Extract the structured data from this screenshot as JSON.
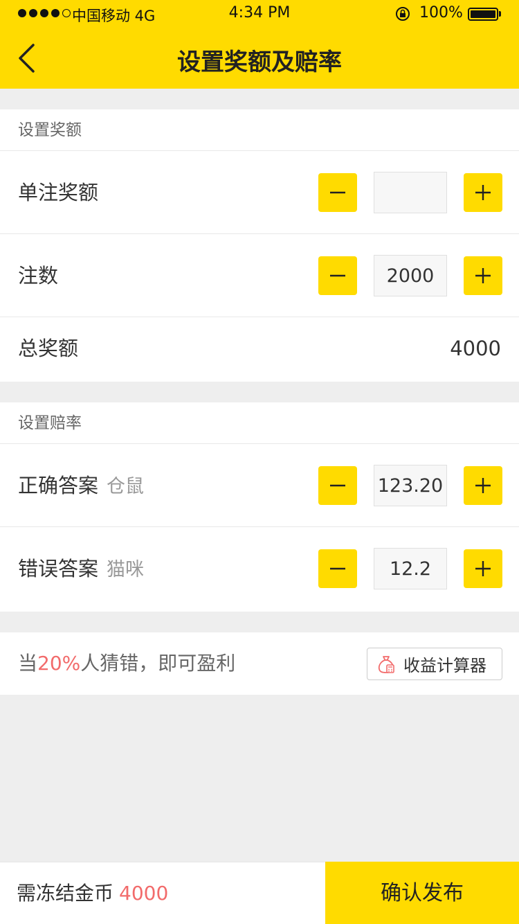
{
  "status_bar": {
    "carrier": "中国移动  4G",
    "time": "4:34 PM",
    "battery": "100%"
  },
  "nav": {
    "title": "设置奖额及赔率",
    "back_icon": "chevron-left-icon"
  },
  "prize_section": {
    "title": "设置奖额",
    "single_bet": {
      "label": "单注奖额",
      "value": ""
    },
    "bet_count": {
      "label": "注数",
      "value": "2000"
    },
    "total": {
      "label": "总奖额",
      "value": "4000"
    }
  },
  "odds_section": {
    "title": "设置赔率",
    "correct": {
      "label": "正确答案",
      "hint": "仓鼠",
      "value": "123.20"
    },
    "wrong": {
      "label": "错误答案",
      "hint": "猫咪",
      "value": "12.2"
    }
  },
  "profit": {
    "prefix": "当",
    "percent": "20%",
    "suffix": "人猜错，即可盈利",
    "calculator_label": "收益计算器",
    "calculator_icon": "money-bag-icon"
  },
  "bottom": {
    "freeze_label": "需冻结金币",
    "freeze_amount": "4000",
    "confirm_label": "确认发布"
  },
  "colors": {
    "accent": "#ffdb00",
    "highlight": "#f26b6b",
    "text_primary": "#333333",
    "text_secondary": "#666666",
    "text_hint": "#999999",
    "background": "#eeeeee"
  }
}
